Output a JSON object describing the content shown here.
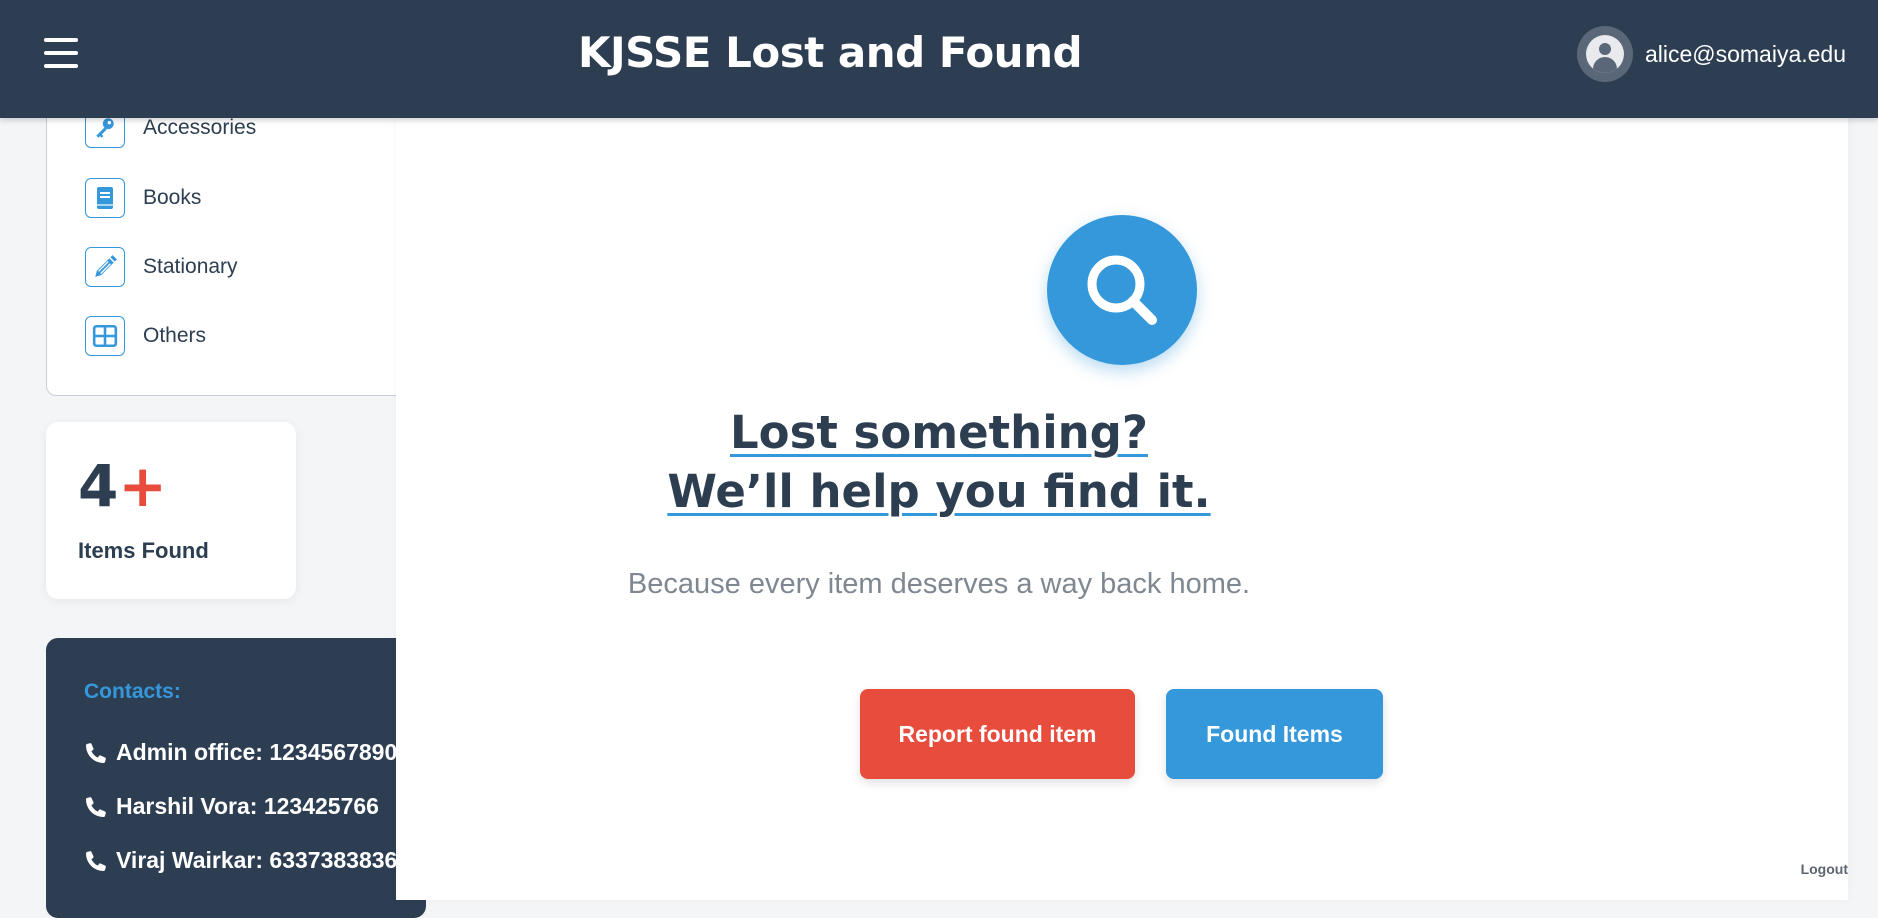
{
  "header": {
    "title": "KJSSE Lost and Found",
    "user_email": "alice@somaiya.edu",
    "menu_icon": "hamburger-icon",
    "avatar_icon": "user-avatar-icon"
  },
  "sidebar": {
    "categories": [
      {
        "label": "Accessories",
        "icon": "key-icon"
      },
      {
        "label": "Books",
        "icon": "book-icon"
      },
      {
        "label": "Stationary",
        "icon": "pencil-icon"
      },
      {
        "label": "Others",
        "icon": "grid-icon"
      }
    ],
    "stats": {
      "count": "4",
      "plus": "+",
      "label": "Items Found"
    },
    "contacts": {
      "title": "Contacts:",
      "items": [
        "Admin office: 1234567890",
        "Harshil Vora: 123425766",
        "Viraj Wairkar: 6337383836"
      ]
    }
  },
  "hero": {
    "line1": "Lost something?",
    "line2": "We’ll help you find it.",
    "subtitle": "Because every item deserves a way back home.",
    "report_button": "Report found item",
    "found_button": "Found Items"
  },
  "footer": {
    "logout": "Logout"
  },
  "colors": {
    "primary": "#3498db",
    "danger": "#e74c3c",
    "dark": "#2e3e52"
  }
}
